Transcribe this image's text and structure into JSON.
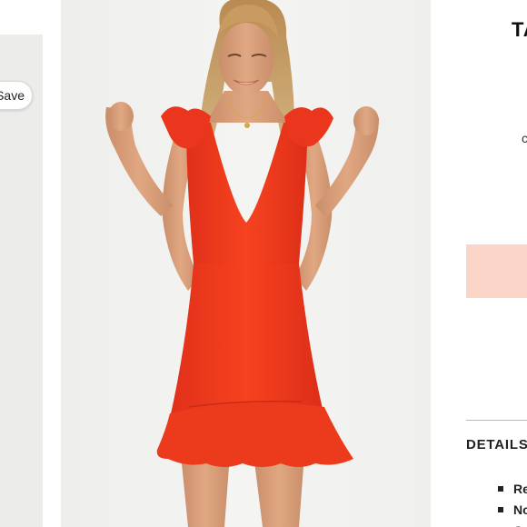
{
  "thumbnail": {
    "save_label": "Save"
  },
  "product": {
    "title_partial": "TA",
    "small_mark": "c",
    "add_button_color": "#fcd5c9",
    "dress_color": "#f1381c"
  },
  "details": {
    "heading": "DETAILS",
    "items": [
      {
        "label": "Re"
      },
      {
        "label": "No"
      },
      {
        "label": "C"
      }
    ]
  }
}
